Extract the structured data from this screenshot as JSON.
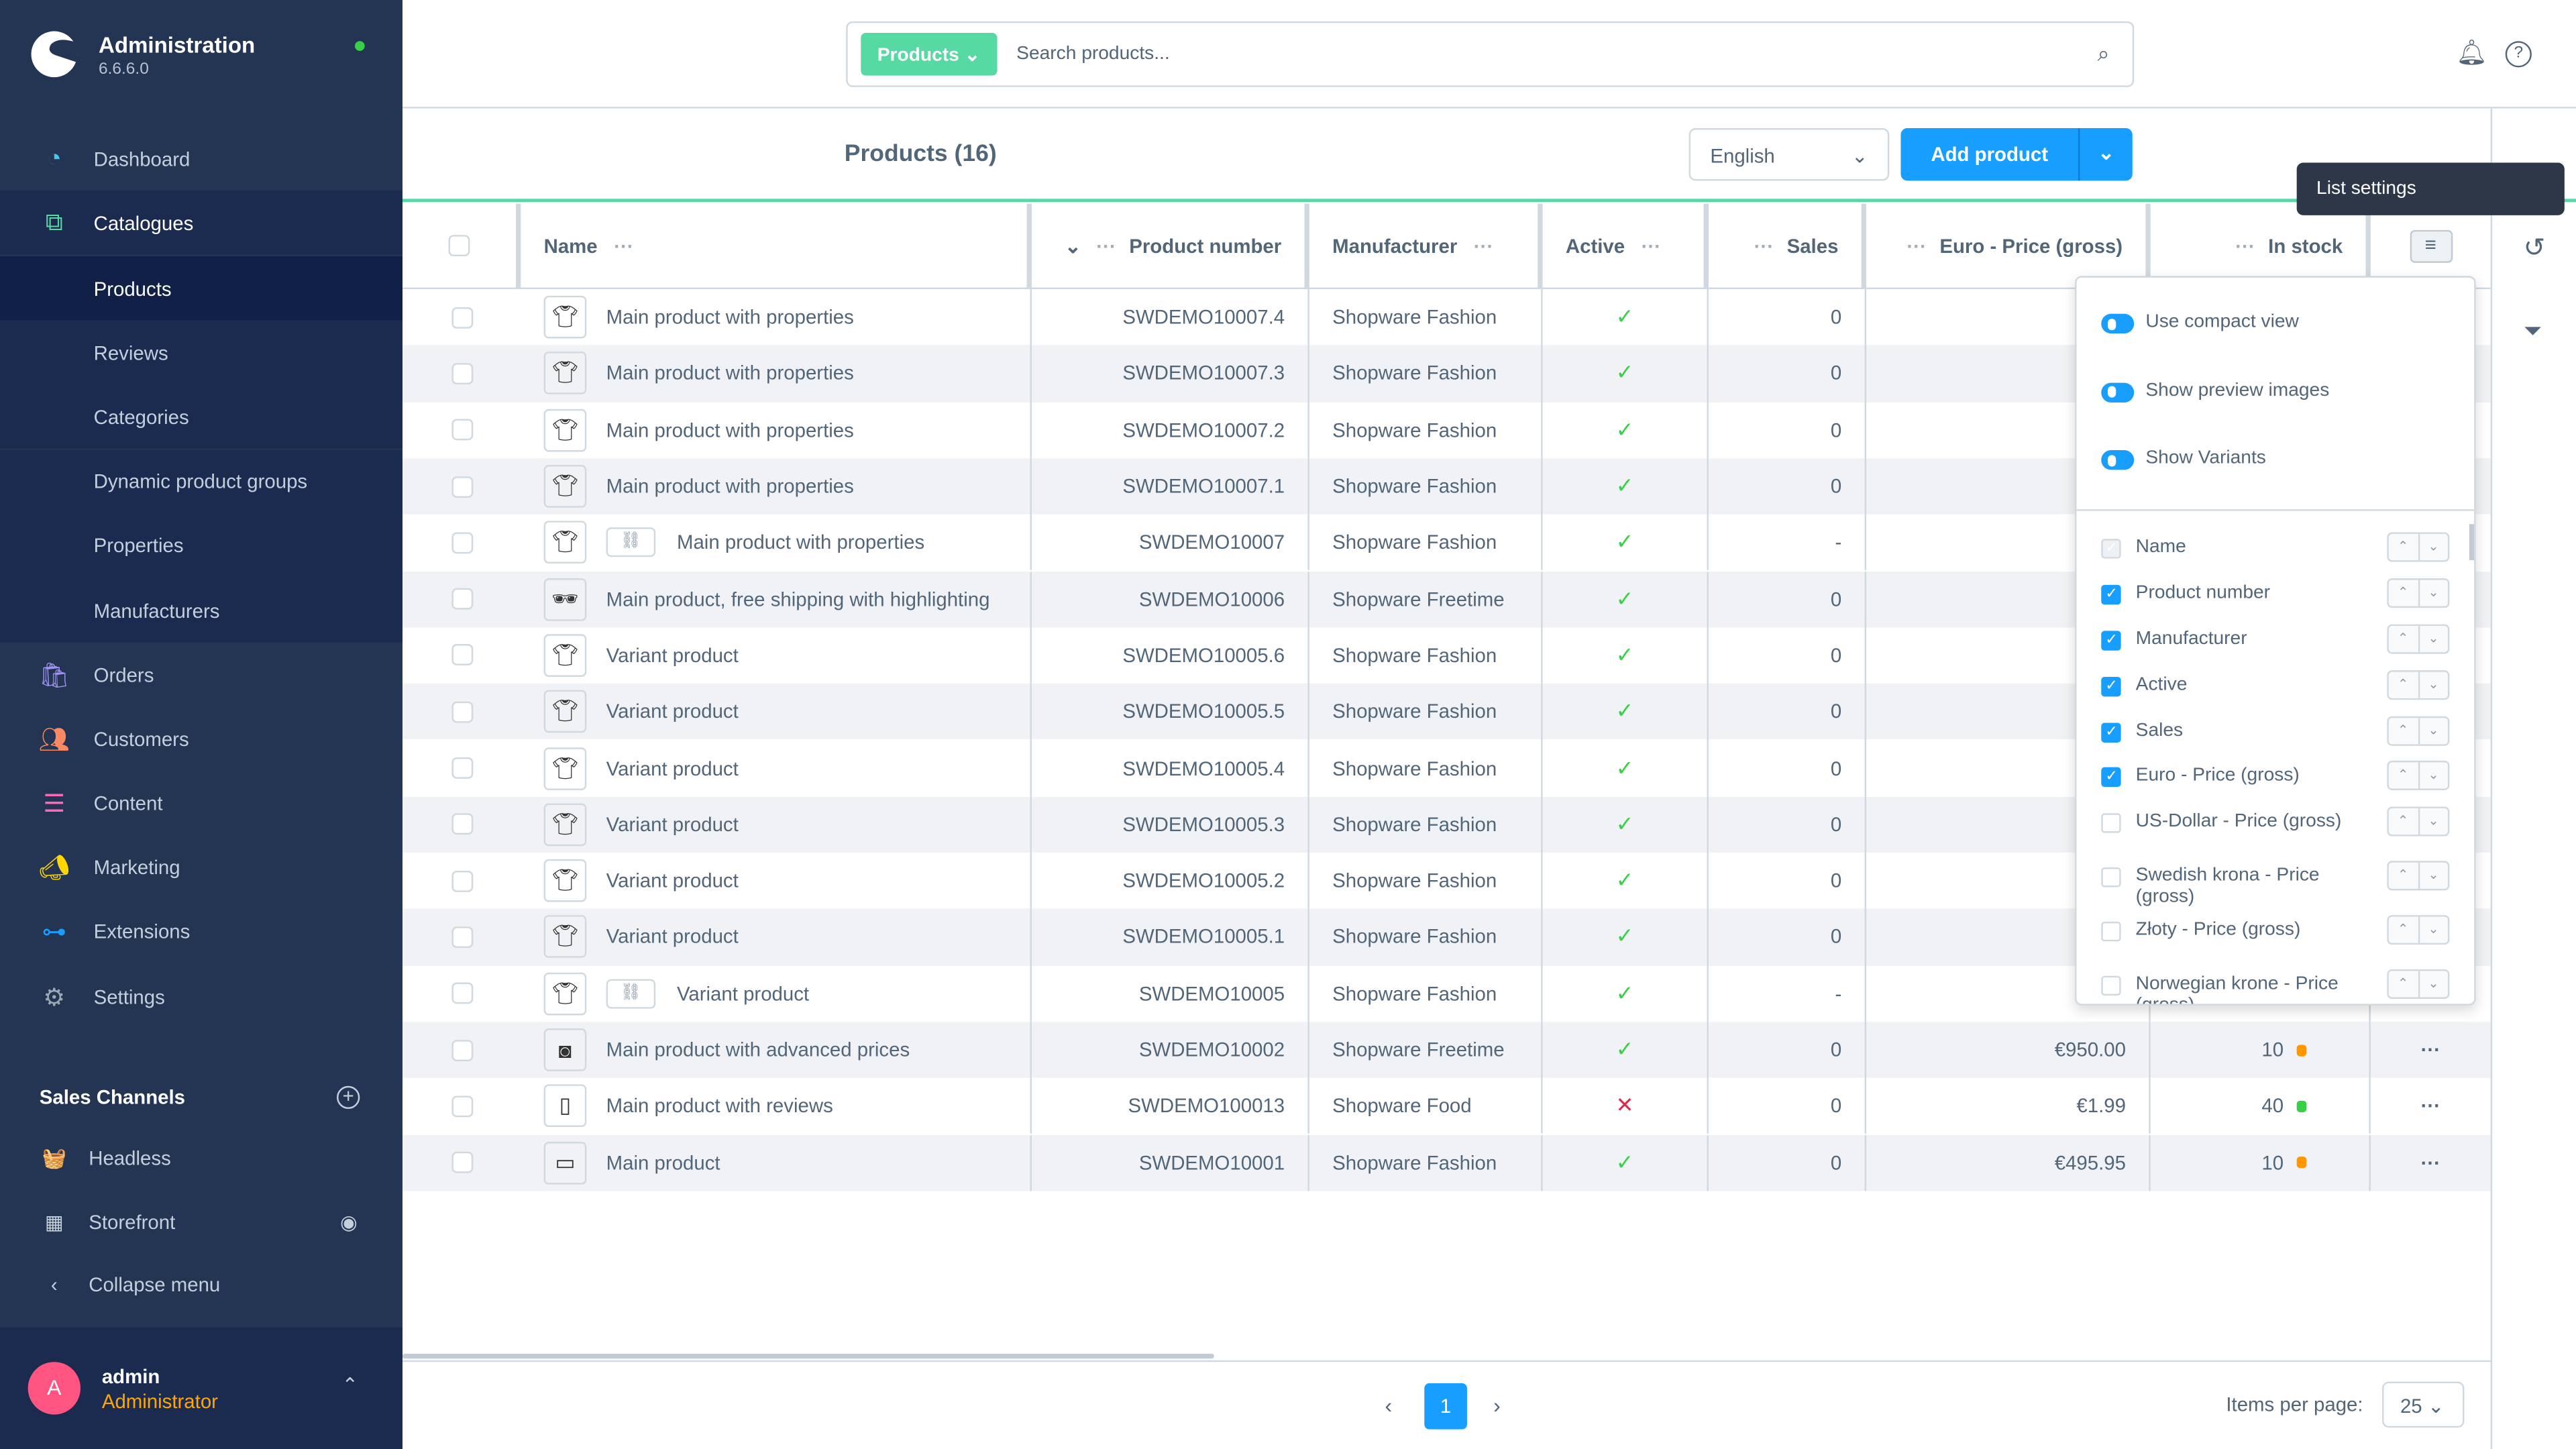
{
  "app": {
    "title": "Administration",
    "version": "6.6.6.0"
  },
  "sidebar": {
    "items": [
      {
        "label": "Dashboard",
        "icon": "dashboard-icon"
      },
      {
        "label": "Catalogues",
        "icon": "catalogues-icon"
      }
    ],
    "sub": [
      "Products",
      "Reviews",
      "Categories",
      "Dynamic product groups",
      "Properties",
      "Manufacturers"
    ],
    "more": [
      {
        "label": "Orders",
        "icon": "orders-icon"
      },
      {
        "label": "Customers",
        "icon": "customers-icon"
      },
      {
        "label": "Content",
        "icon": "content-icon"
      },
      {
        "label": "Marketing",
        "icon": "marketing-icon"
      },
      {
        "label": "Extensions",
        "icon": "extensions-icon"
      },
      {
        "label": "Settings",
        "icon": "settings-icon"
      }
    ],
    "sales_channels_title": "Sales Channels",
    "channels": [
      {
        "label": "Headless"
      },
      {
        "label": "Storefront"
      }
    ],
    "collapse": "Collapse menu",
    "user": {
      "initial": "A",
      "name": "admin",
      "role": "Administrator"
    }
  },
  "search": {
    "type": "Products",
    "placeholder": "Search products..."
  },
  "header": {
    "title": "Products (16)",
    "language": "English",
    "add": "Add product"
  },
  "columns": [
    "Name",
    "Product number",
    "Manufacturer",
    "Active",
    "Sales",
    "Euro - Price (gross)",
    "In stock"
  ],
  "rows": [
    {
      "name": "Main product with properties",
      "num": "SWDEMO10007.4",
      "man": "Shopware Fashion",
      "active": true,
      "sales": "0",
      "price": "",
      "stock": "",
      "variant": false
    },
    {
      "name": "Main product with properties",
      "num": "SWDEMO10007.3",
      "man": "Shopware Fashion",
      "active": true,
      "sales": "0",
      "price": "",
      "stock": "",
      "variant": false
    },
    {
      "name": "Main product with properties",
      "num": "SWDEMO10007.2",
      "man": "Shopware Fashion",
      "active": true,
      "sales": "0",
      "price": "",
      "stock": "",
      "variant": false
    },
    {
      "name": "Main product with properties",
      "num": "SWDEMO10007.1",
      "man": "Shopware Fashion",
      "active": true,
      "sales": "0",
      "price": "",
      "stock": "",
      "variant": false
    },
    {
      "name": "Main product with properties",
      "num": "SWDEMO10007",
      "man": "Shopware Fashion",
      "active": true,
      "sales": "-",
      "price": "",
      "stock": "",
      "variant": true
    },
    {
      "name": "Main product, free shipping with highlighting",
      "num": "SWDEMO10006",
      "man": "Shopware Freetime",
      "active": true,
      "sales": "0",
      "price": "",
      "stock": "",
      "variant": false
    },
    {
      "name": "Variant product",
      "num": "SWDEMO10005.6",
      "man": "Shopware Fashion",
      "active": true,
      "sales": "0",
      "price": "",
      "stock": "",
      "variant": false
    },
    {
      "name": "Variant product",
      "num": "SWDEMO10005.5",
      "man": "Shopware Fashion",
      "active": true,
      "sales": "0",
      "price": "",
      "stock": "",
      "variant": false
    },
    {
      "name": "Variant product",
      "num": "SWDEMO10005.4",
      "man": "Shopware Fashion",
      "active": true,
      "sales": "0",
      "price": "",
      "stock": "",
      "variant": false
    },
    {
      "name": "Variant product",
      "num": "SWDEMO10005.3",
      "man": "Shopware Fashion",
      "active": true,
      "sales": "0",
      "price": "",
      "stock": "",
      "variant": false
    },
    {
      "name": "Variant product",
      "num": "SWDEMO10005.2",
      "man": "Shopware Fashion",
      "active": true,
      "sales": "0",
      "price": "",
      "stock": "",
      "variant": false
    },
    {
      "name": "Variant product",
      "num": "SWDEMO10005.1",
      "man": "Shopware Fashion",
      "active": true,
      "sales": "0",
      "price": "",
      "stock": "",
      "variant": false
    },
    {
      "name": "Variant product",
      "num": "SWDEMO10005",
      "man": "Shopware Fashion",
      "active": true,
      "sales": "-",
      "price": "",
      "stock": "",
      "variant": true
    },
    {
      "name": "Main product with advanced prices",
      "num": "SWDEMO10002",
      "man": "Shopware Freetime",
      "active": true,
      "sales": "0",
      "price": "€950.00",
      "stock": "10",
      "stock_color": "#ff9800",
      "variant": false
    },
    {
      "name": "Main product with reviews",
      "num": "SWDEMO100013",
      "man": "Shopware Food",
      "active": false,
      "sales": "0",
      "price": "€1.99",
      "stock": "40",
      "stock_color": "#37d046",
      "variant": false
    },
    {
      "name": "Main product",
      "num": "SWDEMO10001",
      "man": "Shopware Fashion",
      "active": true,
      "sales": "0",
      "price": "€495.95",
      "stock": "10",
      "stock_color": "#ff9800",
      "variant": false
    }
  ],
  "tooltip": "List settings",
  "settings": {
    "toggles": [
      {
        "label": "Use compact view",
        "on": true
      },
      {
        "label": "Show preview images",
        "on": true
      },
      {
        "label": "Show Variants",
        "on": true
      }
    ],
    "cols": [
      {
        "label": "Name",
        "checked": true,
        "disabled": true
      },
      {
        "label": "Product number",
        "checked": true
      },
      {
        "label": "Manufacturer",
        "checked": true
      },
      {
        "label": "Active",
        "checked": true
      },
      {
        "label": "Sales",
        "checked": true
      },
      {
        "label": "Euro - Price (gross)",
        "checked": true
      },
      {
        "label": "US-Dollar - Price (gross)",
        "checked": false
      },
      {
        "label": "Swedish krona - Price (gross)",
        "checked": false
      },
      {
        "label": "Złoty - Price (gross)",
        "checked": false
      },
      {
        "label": "Norwegian krone - Price (gross)",
        "checked": false
      }
    ]
  },
  "pagination": {
    "page": "1",
    "per_page_label": "Items per page:",
    "per_page": "25"
  },
  "colors": {
    "accent": "#189eff",
    "brand_green": "#57d9a3",
    "sidebar": "#243554"
  }
}
